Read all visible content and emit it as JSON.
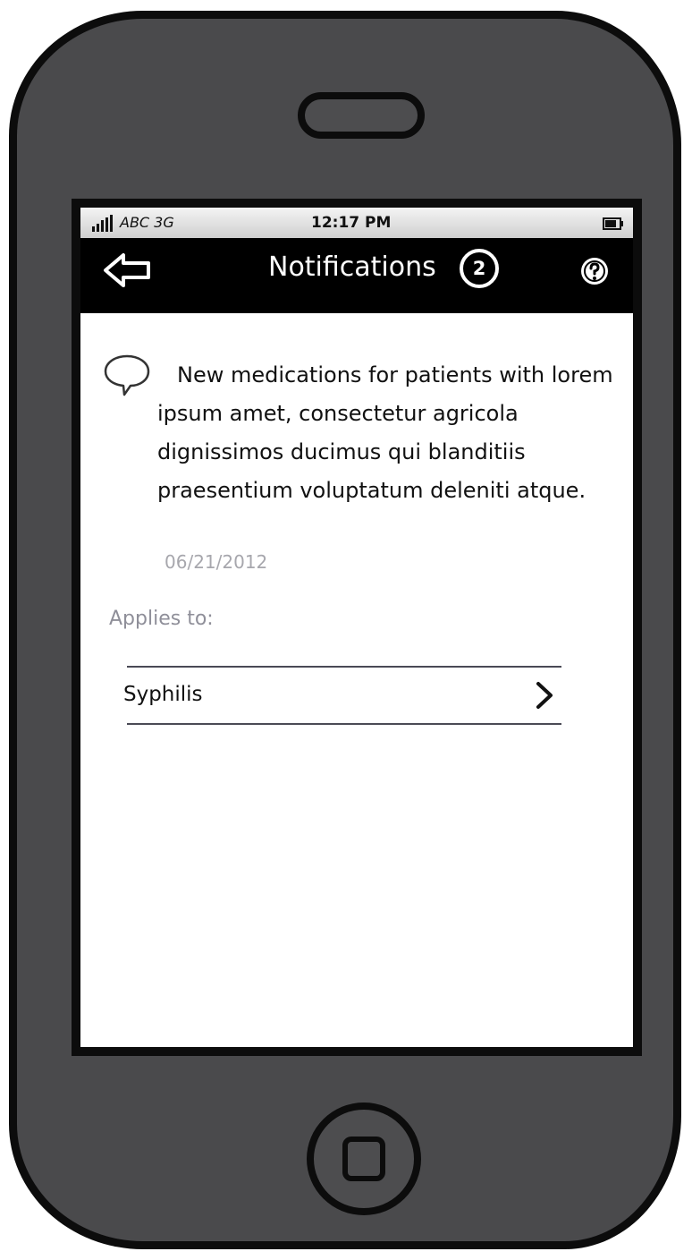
{
  "status_bar": {
    "carrier": "ABC 3G",
    "time": "12:17 PM",
    "signal_icon": "signal-bars-icon",
    "battery_icon": "battery-icon"
  },
  "nav_bar": {
    "back_icon": "back-arrow-icon",
    "title": "Notifications",
    "badge_count": "2",
    "help_icon": "help-icon"
  },
  "notification": {
    "icon": "speech-bubble-icon",
    "message": "New medications for patients with lorem ipsum amet, consectetur agricola dignissimos ducimus qui blanditiis praesentium voluptatum deleniti atque.",
    "date": "06/21/2012"
  },
  "applies_to": {
    "label": "Applies to:",
    "items": [
      {
        "label": "Syphilis",
        "icon": "chevron-right-icon"
      }
    ]
  },
  "device": {
    "speaker_icon": "speaker-icon",
    "home_icon": "home-button-icon"
  },
  "colors": {
    "device_body": "#4a4a4c",
    "nav_bar": "#000000",
    "content_bg": "#ffffff",
    "muted_text": "#a7a7ad",
    "section_label": "#8f8f99"
  }
}
